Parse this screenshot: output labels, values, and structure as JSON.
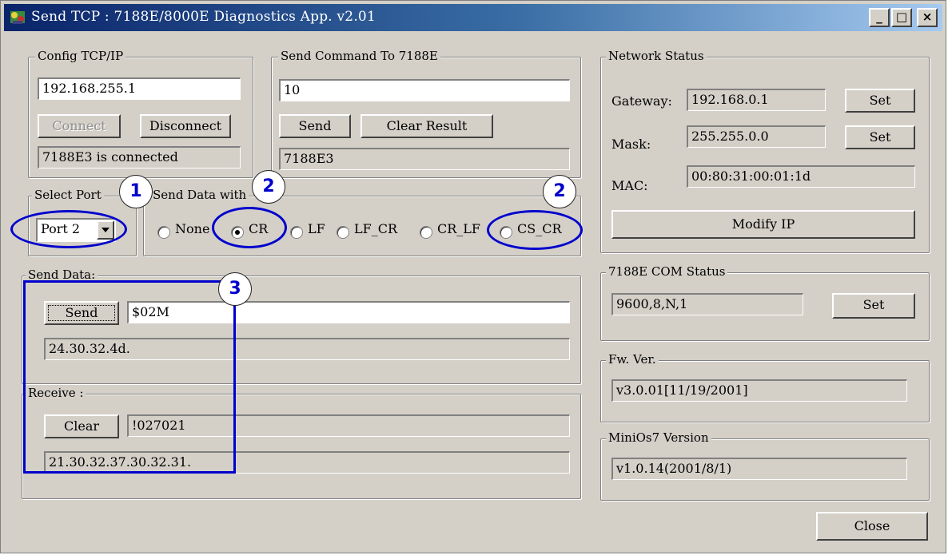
{
  "window": {
    "title": "Send TCP : 7188E/8000E Diagnostics App. v2.01",
    "buttons": {
      "minimize": "_",
      "maximize": "□",
      "close": "×"
    }
  },
  "config_tcpip": {
    "label": "Config TCP/IP",
    "ip_value": "192.168.255.1",
    "connect_label": "Connect",
    "disconnect_label": "Disconnect",
    "status": "7188E3 is connected"
  },
  "send_command": {
    "label": "Send Command To 7188E",
    "command_value": "10",
    "send_label": "Send",
    "clear_result_label": "Clear Result",
    "result": "7188E3"
  },
  "select_port": {
    "label": "Select Port",
    "selected": "Port 2"
  },
  "send_data_with": {
    "label": "Send Data with",
    "options": [
      "None",
      "CR",
      "LF",
      "LF_CR",
      "CR_LF",
      "CS_CR"
    ],
    "selected": "CR"
  },
  "send_data": {
    "label": "Send Data:",
    "send_label": "Send",
    "data_value": "$02M",
    "hex": "24.30.32.4d."
  },
  "receive": {
    "label": "Receive :",
    "clear_label": "Clear",
    "value": "!027021",
    "hex": "21.30.32.37.30.32.31."
  },
  "network_status": {
    "label": "Network Status",
    "gateway_label": "Gateway:",
    "gateway_value": "192.168.0.1",
    "mask_label": "Mask:",
    "mask_value": "255.255.0.0",
    "mac_label": "MAC:",
    "mac_value": "00:80:31:00:01:1d",
    "set_label": "Set",
    "modify_ip_label": "Modify IP"
  },
  "com_status": {
    "label": "7188E COM Status",
    "value": "9600,8,N,1",
    "set_label": "Set"
  },
  "fw_ver": {
    "label": "Fw. Ver.",
    "value": "v3.0.01[11/19/2001]"
  },
  "minios7": {
    "label": "MiniOs7 Version",
    "value": "v1.0.14(2001/8/1)"
  },
  "close_label": "Close",
  "callouts": [
    "1",
    "2",
    "2",
    "3"
  ],
  "colors": {
    "title_gradient_start": "#0a246a",
    "title_gradient_end": "#a6caf0",
    "annotation": "#0000cc",
    "window_bg": "#d4d0c8"
  }
}
